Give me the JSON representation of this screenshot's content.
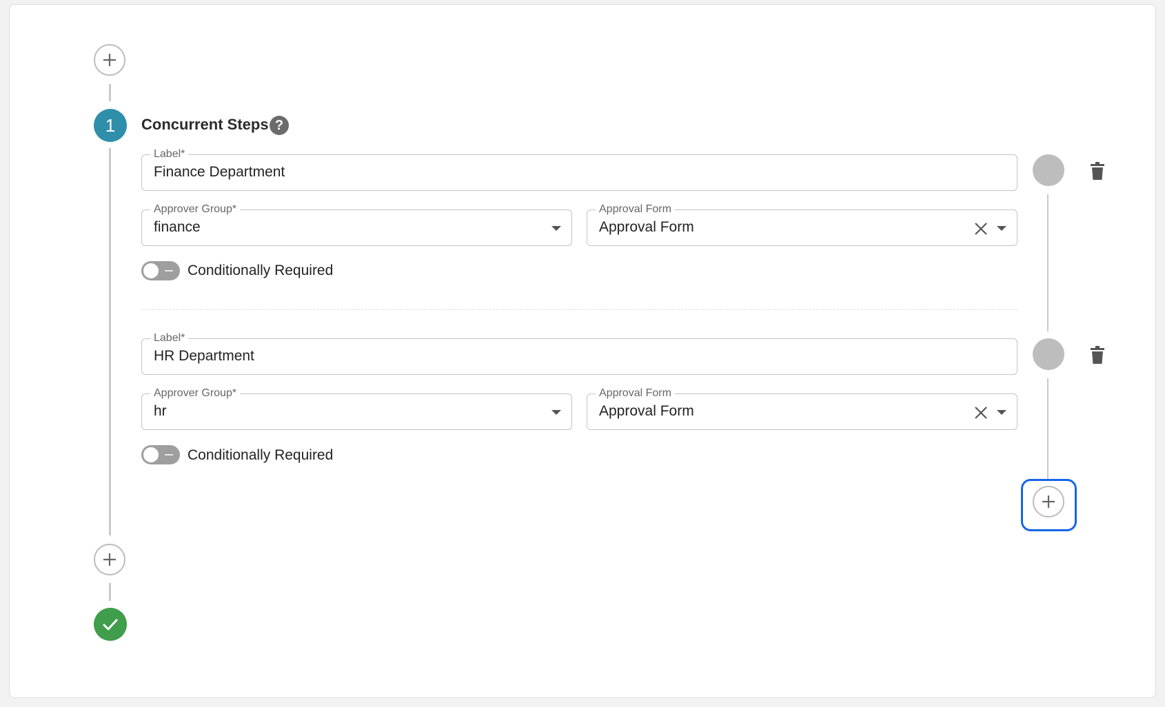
{
  "section": {
    "step_number": "1",
    "title": "Concurrent Steps",
    "help_glyph": "?"
  },
  "steps": [
    {
      "label_caption": "Label*",
      "label_value": "Finance Department",
      "approver_caption": "Approver Group*",
      "approver_value": "finance",
      "form_caption": "Approval Form",
      "form_value": "Approval Form",
      "toggle_label": "Conditionally Required",
      "conditionally_required": false
    },
    {
      "label_caption": "Label*",
      "label_value": "HR Department",
      "approver_caption": "Approver Group*",
      "approver_value": "hr",
      "form_caption": "Approval Form",
      "form_value": "Approval Form",
      "toggle_label": "Conditionally Required",
      "conditionally_required": false
    }
  ],
  "colors": {
    "step_badge": "#2f8fab",
    "done_badge": "#3f9d4b",
    "focus_ring": "#1565e8",
    "connector": "#c9c9c9"
  },
  "icons": [
    "plus-icon",
    "help-icon",
    "trash-icon",
    "clear-icon",
    "chevron-down-icon",
    "check-icon"
  ]
}
